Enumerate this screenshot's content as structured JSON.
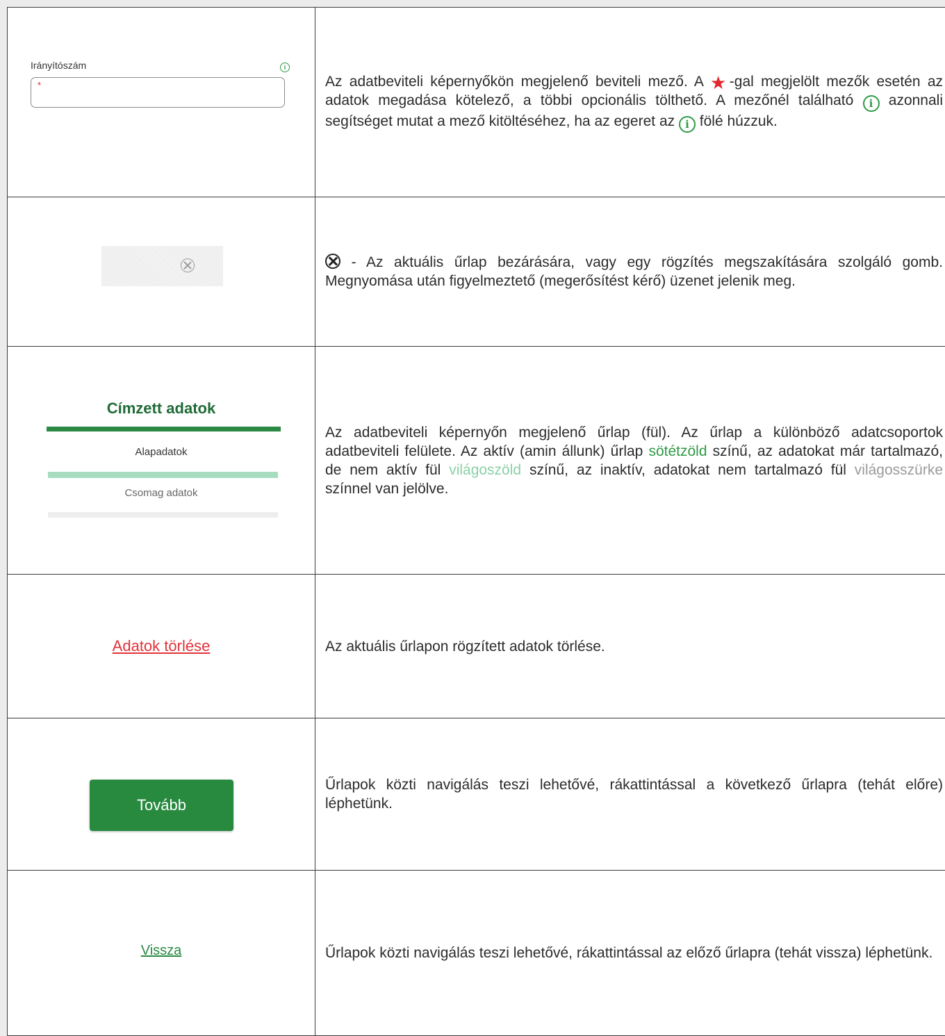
{
  "rows": [
    {
      "illustration": {
        "field_label": "Irányítószám",
        "required_mark": "*"
      },
      "description": {
        "part1": "Az adatbeviteli képernyőkön megjelenő beviteli mező. A ",
        "part2": "-gal megjelölt mezők esetén az adatok megadása kötelező, a többi opcionális tölthető. A mezőnél található ",
        "part3": " azonnali segítséget mutat a mező kitöltéséhez, ha az egeret az ",
        "part4": " fölé húzzuk."
      }
    },
    {
      "illustration": {},
      "description": {
        "part1": " - Az aktuális űrlap bezárására, vagy egy rögzítés megszakítására szolgáló gomb. Megnyomása után figyelmeztető (megerősítést kérő) üzenet jelenik meg."
      }
    },
    {
      "illustration": {
        "tab_active": "Címzett adatok",
        "tab_filled": "Alapadatok",
        "tab_empty": "Csomag adatok"
      },
      "description": {
        "part1": "Az adatbeviteli képernyőn megjelenő űrlap (fül). Az űrlap a különböző adatcsoportok adatbeviteli felülete. Az aktív (amin állunk) űrlap ",
        "dark_green": "sötétzöld",
        "part2": " színű, az adatokat már tartalmazó, de nem aktív fül ",
        "light_green": "világoszöld",
        "part3": " színű, az inaktív, adatokat nem tartalmazó fül ",
        "light_grey": "világosszürke",
        "part4": " színnel van jelölve."
      }
    },
    {
      "illustration": {
        "link": "Adatok törlése"
      },
      "description": {
        "part1": "Az aktuális űrlapon rögzített adatok törlése."
      }
    },
    {
      "illustration": {
        "button": "Tovább"
      },
      "description": {
        "part1": "Űrlapok közti navigálás teszi lehetővé, rákattintással a következő űrlapra (tehát előre) léphetünk."
      }
    },
    {
      "illustration": {
        "link": "Vissza"
      },
      "description": {
        "part1": "Űrlapok közti navigálás teszi lehetővé, rákattintással az előző űrlapra (tehát vissza) léphetünk."
      }
    }
  ],
  "icons": {
    "info": "i",
    "required": "★"
  },
  "colors": {
    "dark_green": "#2e9a45",
    "light_green": "#8ad0a6",
    "light_grey": "#9a9a9a",
    "delete_red": "#e0323a",
    "button_green": "#278a3f"
  }
}
